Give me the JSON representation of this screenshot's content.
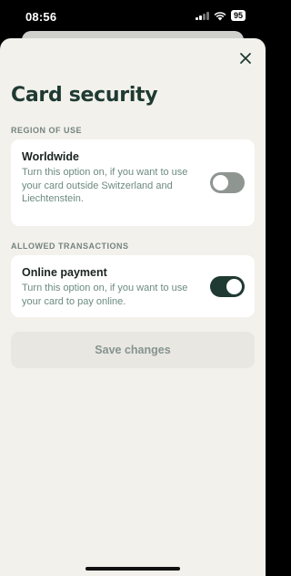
{
  "status_bar": {
    "time": "08:56",
    "battery": "95"
  },
  "sheet": {
    "title": "Card security",
    "close_icon": "close-icon"
  },
  "region_section": {
    "label": "REGION OF USE",
    "option": {
      "title": "Worldwide",
      "description": "Turn this option on, if you want to use your card outside Switzerland and Liechtenstein.",
      "enabled": false
    }
  },
  "transactions_section": {
    "label": "ALLOWED TRANSACTIONS",
    "option": {
      "title": "Online payment",
      "description": "Turn this option on, if you want to use your card to pay online.",
      "enabled": true
    }
  },
  "actions": {
    "save_label": "Save changes"
  },
  "colors": {
    "accent": "#1f3a32",
    "background": "#f2f1ec",
    "card": "#ffffff",
    "muted_text": "#6c8a81"
  }
}
